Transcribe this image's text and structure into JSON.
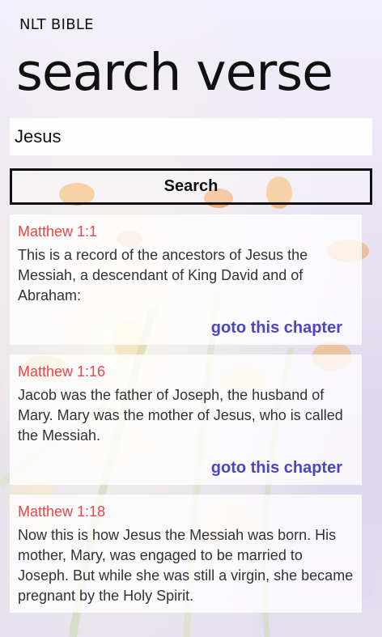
{
  "header": {
    "app_title": "NLT BIBLE",
    "page_title": "search verse"
  },
  "search": {
    "query": "Jesus",
    "button_label": "Search"
  },
  "results": [
    {
      "reference": "Matthew 1:1",
      "text": "This is a record of the ancestors of Jesus the Messiah, a descendant of King David and of Abraham:",
      "link": "goto this chapter"
    },
    {
      "reference": "Matthew 1:16",
      "text": "Jacob was the father of Joseph, the husband of Mary. Mary was the mother of Jesus, who is called the Messiah.",
      "link": "goto this chapter"
    },
    {
      "reference": "Matthew 1:18",
      "text": "Now this is how Jesus the Messiah was born. His mother, Mary, was engaged to be married to Joseph. But while she was still a virgin, she became pregnant by the Holy Spirit."
    }
  ],
  "colors": {
    "reference": "#e8474a",
    "link": "#4b45c6",
    "background": "#ece6f4"
  }
}
